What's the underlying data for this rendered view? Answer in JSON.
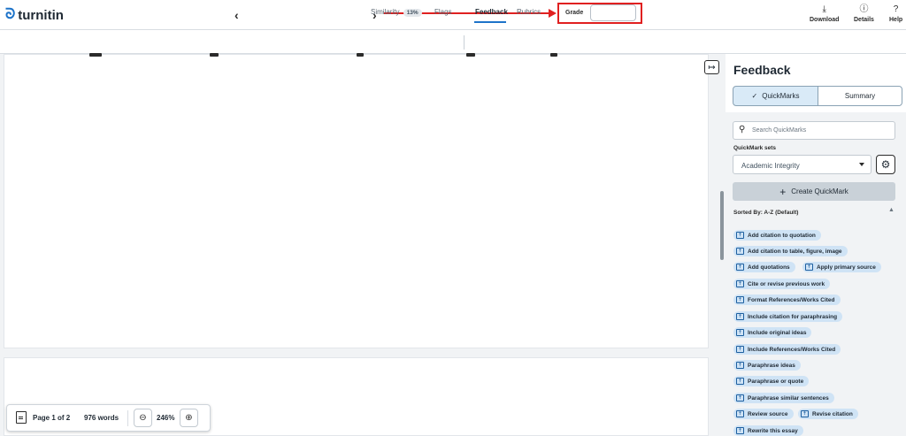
{
  "app": {
    "logo_text": "turnitin"
  },
  "header": {
    "grade_label": "Grade",
    "grade_value": "",
    "download_label": "Download",
    "details_label": "Details",
    "help_label": "Help"
  },
  "tabs": {
    "similarity_label": "Similarity",
    "similarity_pct": "13%",
    "flags_label": "Flags",
    "feedback_label": "Feedback",
    "rubrics_label": "Rubrics"
  },
  "page_control": {
    "page_label": "Page 1 of 2",
    "words_label": "976 words",
    "zoom_label": "246%"
  },
  "feedback": {
    "title": "Feedback",
    "quickmarks_tab": "QuickMarks",
    "summary_tab": "Summary",
    "search_placeholder": "Search QuickMarks",
    "sets_label": "QuickMark sets",
    "selected_set": "Academic Integrity",
    "create_label": "Create QuickMark",
    "sorted_label": "Sorted By: A-Z (Default)",
    "quickmarks": [
      "Add citation to quotation",
      "Add citation to table, figure, image",
      "Add quotations",
      "Apply primary source",
      "Cite or revise previous work",
      "Format References/Works Cited",
      "Include citation for paraphrasing",
      "Include original ideas",
      "Include References/Works Cited",
      "Paraphrase ideas",
      "Paraphrase or quote",
      "Paraphrase similar sentences",
      "Review source",
      "Revise citation",
      "Rewrite this essay"
    ]
  },
  "colors": {
    "accent": "#1d73c9",
    "highlight_red": "#e02020",
    "quickmark_bg": "#cfe3f5"
  }
}
